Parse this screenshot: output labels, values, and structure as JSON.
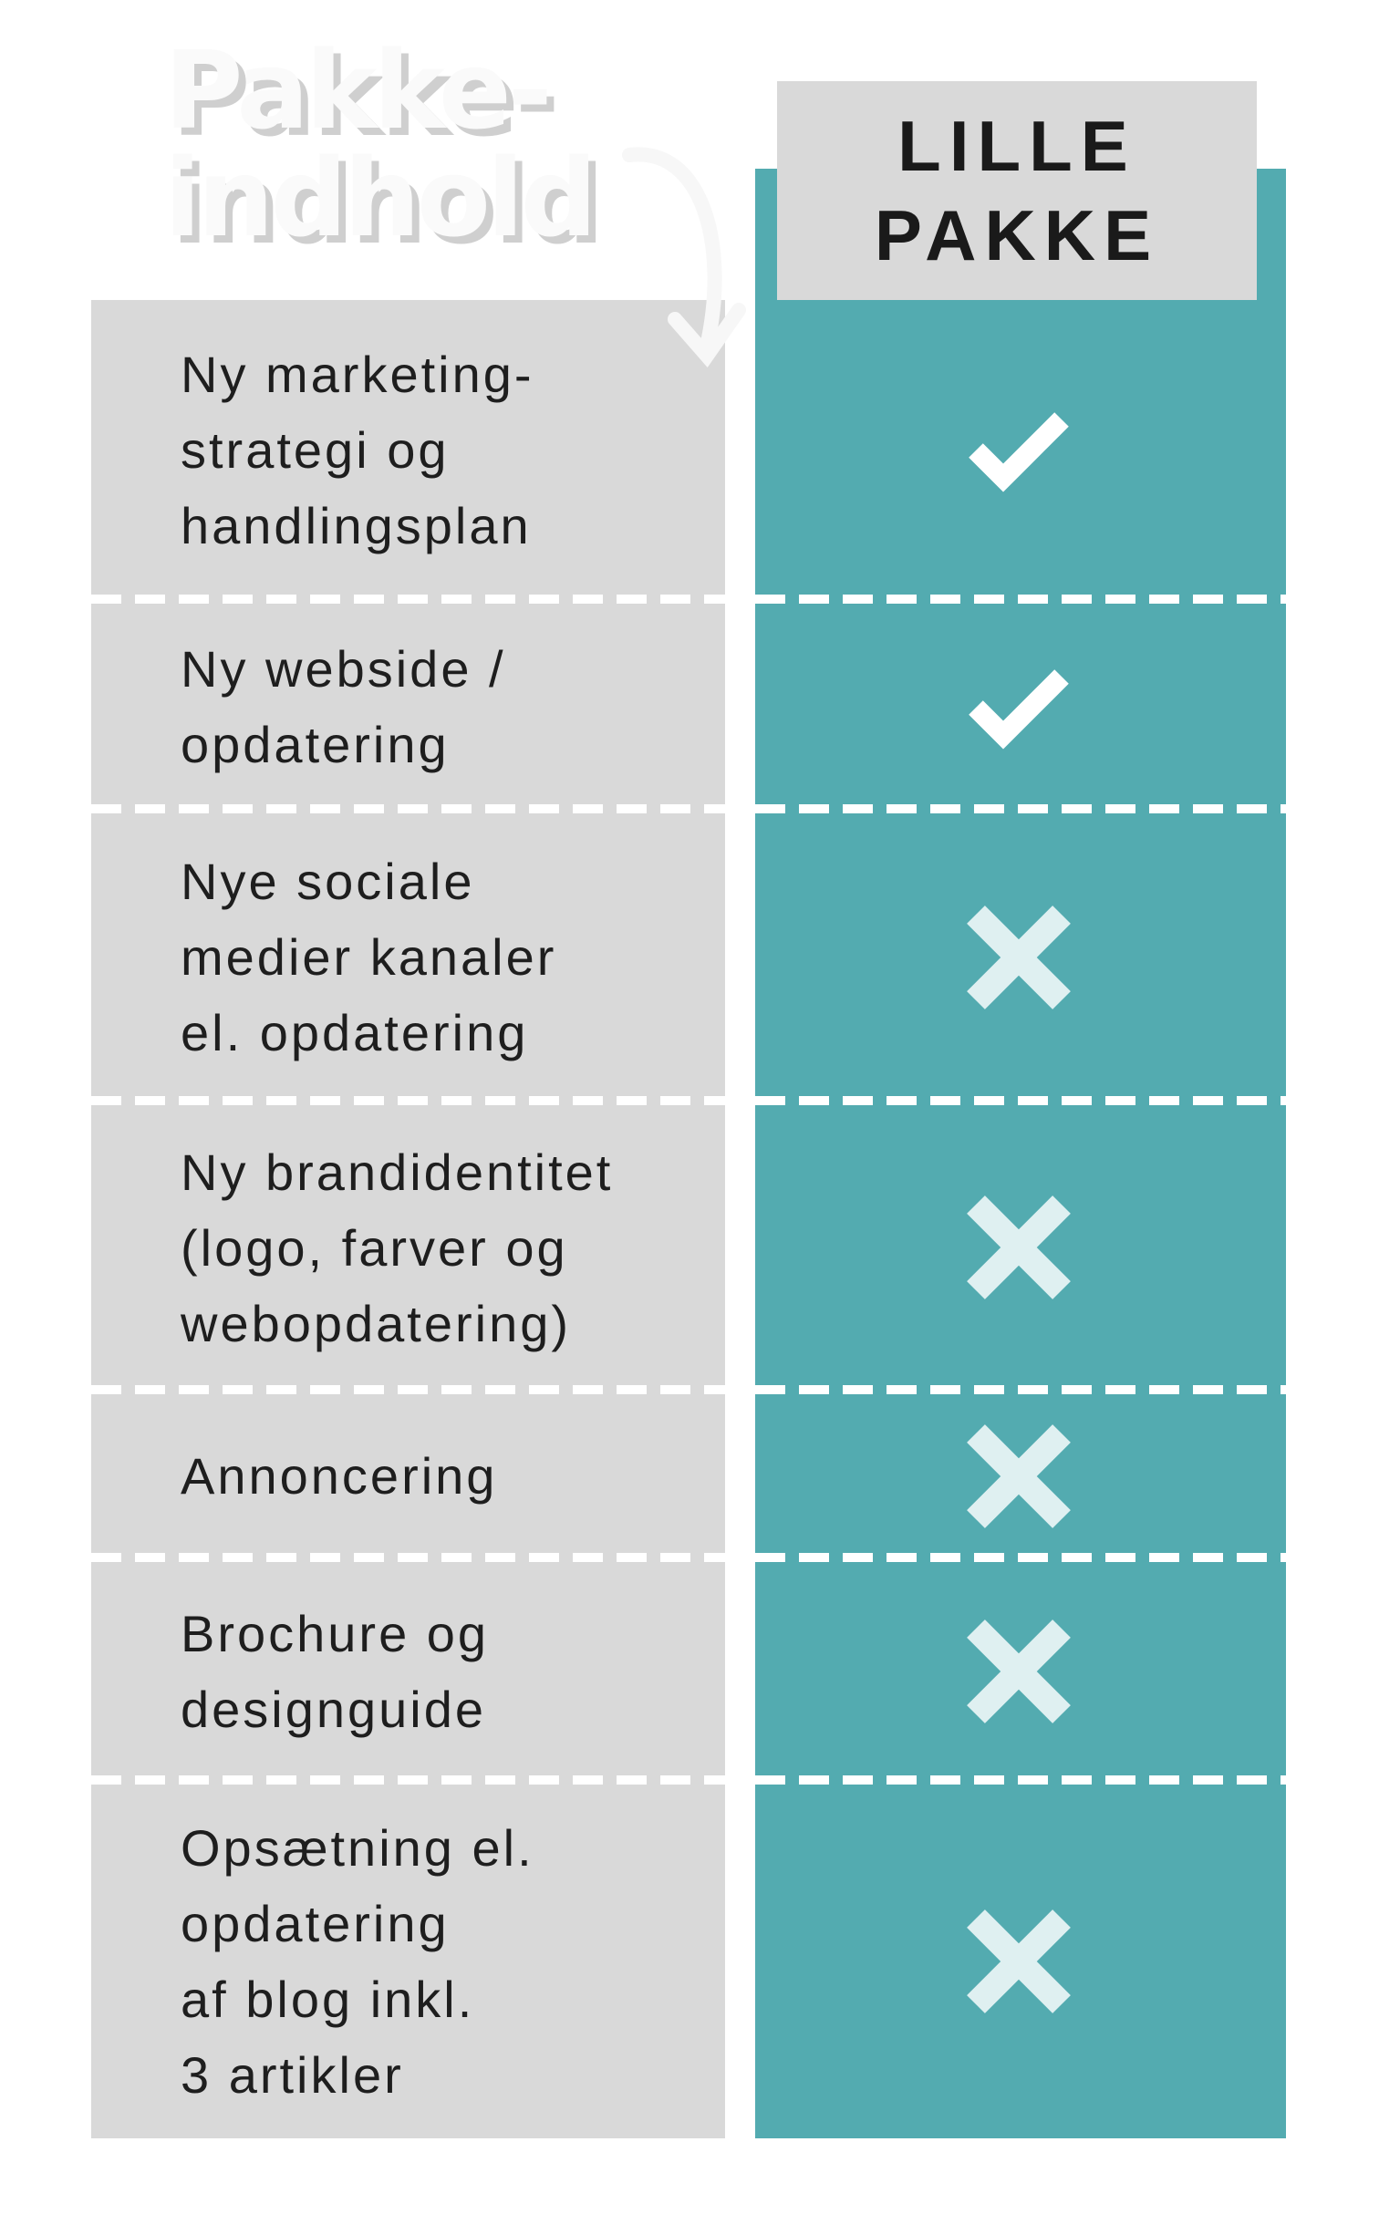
{
  "title": "Pakke-\nindhold",
  "package_header": "LILLE\nPAKKE",
  "colors": {
    "teal": "#53abb0",
    "gray": "#d9d9d9",
    "check": "#ffffff",
    "cross": "#dff0f1"
  },
  "rows": [
    {
      "label": "Ny marketing-\nstrategi  og\nhandlingsplan",
      "included": true,
      "icon": "check-icon"
    },
    {
      "label": "Ny webside /\nopdatering",
      "included": true,
      "icon": "check-icon"
    },
    {
      "label": "Nye sociale\nmedier kanaler\nel. opdatering",
      "included": false,
      "icon": "cross-icon"
    },
    {
      "label": "Ny brandidentitet\n(logo, farver og\nwebopdatering)",
      "included": false,
      "icon": "cross-icon"
    },
    {
      "label": "Annoncering",
      "included": false,
      "icon": "cross-icon"
    },
    {
      "label": "Brochure og\ndesignguide",
      "included": false,
      "icon": "cross-icon"
    },
    {
      "label": "Opsætning el.\nopdatering\naf blog inkl.\n3 artikler",
      "included": false,
      "icon": "cross-icon"
    }
  ]
}
